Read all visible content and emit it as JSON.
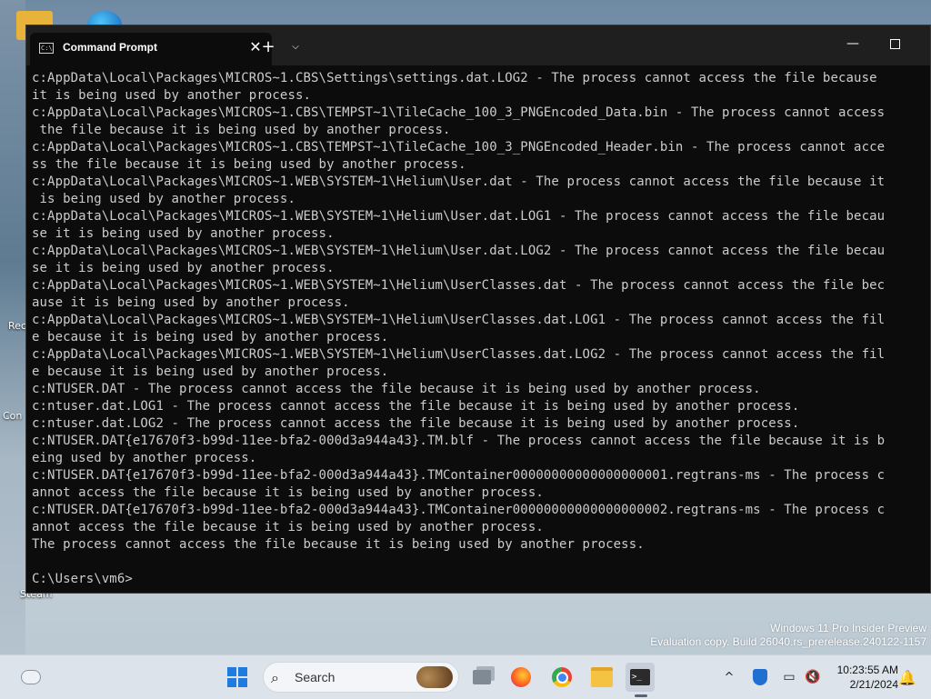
{
  "window": {
    "tab_title": "Command Prompt",
    "tab_icon_text": "C:\\",
    "close_tab_glyph": "✕",
    "new_tab_glyph": "+",
    "dropdown_glyph": "⌵",
    "minimize_glyph": "—"
  },
  "console": {
    "lines": [
      "c:AppData\\Local\\Packages\\MICROS~1.CBS\\Settings\\settings.dat.LOG2 - The process cannot access the file because",
      "it is being used by another process.",
      "c:AppData\\Local\\Packages\\MICROS~1.CBS\\TEMPST~1\\TileCache_100_3_PNGEncoded_Data.bin - The process cannot access",
      " the file because it is being used by another process.",
      "c:AppData\\Local\\Packages\\MICROS~1.CBS\\TEMPST~1\\TileCache_100_3_PNGEncoded_Header.bin - The process cannot acce",
      "ss the file because it is being used by another process.",
      "c:AppData\\Local\\Packages\\MICROS~1.WEB\\SYSTEM~1\\Helium\\User.dat - The process cannot access the file because it",
      " is being used by another process.",
      "c:AppData\\Local\\Packages\\MICROS~1.WEB\\SYSTEM~1\\Helium\\User.dat.LOG1 - The process cannot access the file becau",
      "se it is being used by another process.",
      "c:AppData\\Local\\Packages\\MICROS~1.WEB\\SYSTEM~1\\Helium\\User.dat.LOG2 - The process cannot access the file becau",
      "se it is being used by another process.",
      "c:AppData\\Local\\Packages\\MICROS~1.WEB\\SYSTEM~1\\Helium\\UserClasses.dat - The process cannot access the file bec",
      "ause it is being used by another process.",
      "c:AppData\\Local\\Packages\\MICROS~1.WEB\\SYSTEM~1\\Helium\\UserClasses.dat.LOG1 - The process cannot access the fil",
      "e because it is being used by another process.",
      "c:AppData\\Local\\Packages\\MICROS~1.WEB\\SYSTEM~1\\Helium\\UserClasses.dat.LOG2 - The process cannot access the fil",
      "e because it is being used by another process.",
      "c:NTUSER.DAT - The process cannot access the file because it is being used by another process.",
      "c:ntuser.dat.LOG1 - The process cannot access the file because it is being used by another process.",
      "c:ntuser.dat.LOG2 - The process cannot access the file because it is being used by another process.",
      "c:NTUSER.DAT{e17670f3-b99d-11ee-bfa2-000d3a944a43}.TM.blf - The process cannot access the file because it is b",
      "eing used by another process.",
      "c:NTUSER.DAT{e17670f3-b99d-11ee-bfa2-000d3a944a43}.TMContainer00000000000000000001.regtrans-ms - The process c",
      "annot access the file because it is being used by another process.",
      "c:NTUSER.DAT{e17670f3-b99d-11ee-bfa2-000d3a944a43}.TMContainer00000000000000000002.regtrans-ms - The process c",
      "annot access the file because it is being used by another process.",
      "The process cannot access the file because it is being used by another process.",
      "",
      "C:\\Users\\vm6>"
    ]
  },
  "desktop": {
    "watermark_line1": "Windows 11 Pro Insider Preview",
    "watermark_line2": "Evaluation copy. Build 26040.rs_prerelease.240122-1157",
    "icon_labels": [
      "Rec",
      "Con",
      "Steam"
    ]
  },
  "taskbar": {
    "search_label": "Search",
    "search_glyph": "⌕",
    "chevron_glyph": "^",
    "network_glyph": "▭",
    "volume_glyph": "🔇",
    "bell_glyph": "🔔",
    "clock_time": "10:23:55 AM",
    "clock_date": "2/21/2024",
    "terminal_glyph": ">_"
  }
}
